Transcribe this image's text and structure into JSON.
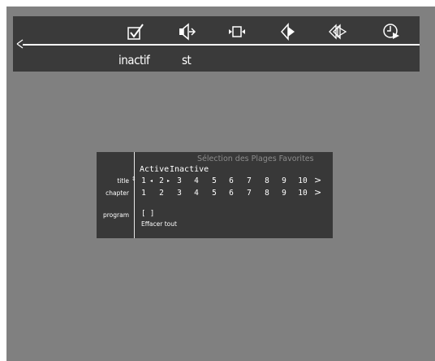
{
  "player": {
    "status": {
      "state": "inactif",
      "mode": "st"
    },
    "icons": [
      "check-icon",
      "audio-speaker-icon",
      "frame-step-icon",
      "angle-icon",
      "fast-forward-icon",
      "time-icon"
    ]
  },
  "dialog": {
    "title": "Sélection des Plages Favorites",
    "mode_active": "Active",
    "mode_inactive": "Inactive",
    "rows": [
      {
        "label": "title",
        "cells": [
          "1",
          "2",
          "3",
          "4",
          "5",
          "6",
          "7",
          "8",
          "9",
          "10"
        ],
        "more": ">"
      },
      {
        "label": "chapter",
        "cells": [
          "1",
          "2",
          "3",
          "4",
          "5",
          "6",
          "7",
          "8",
          "9",
          "10"
        ],
        "more": ">"
      }
    ],
    "program_label": "program",
    "program_value": "[ ]",
    "clear_all": "Effacer tout"
  }
}
